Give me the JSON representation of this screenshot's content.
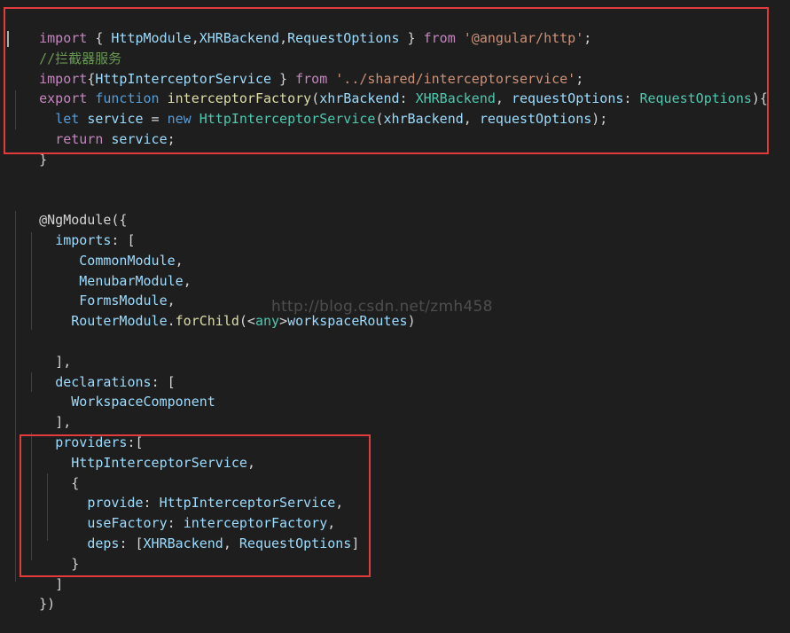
{
  "code": {
    "l1": {
      "t1": "import",
      "t2": " { ",
      "t3": "HttpModule",
      "t4": ",",
      "t5": "XHRBackend",
      "t6": ",",
      "t7": "RequestOptions",
      "t8": " } ",
      "t9": "from",
      "t10": " ",
      "t11": "'@angular/http'",
      "t12": ";"
    },
    "l2": {
      "t1": "//拦截器服务"
    },
    "l3": {
      "t1": "import",
      "t2": "{",
      "t3": "HttpInterceptorService",
      "t4": " } ",
      "t5": "from",
      "t6": " ",
      "t7": "'../shared/interceptorservice'",
      "t8": ";"
    },
    "l4": {
      "t1": "export",
      "t2": " ",
      "t3": "function",
      "t4": " ",
      "t5": "interceptorFactory",
      "t6": "(",
      "t7": "xhrBackend",
      "t8": ": ",
      "t9": "XHRBackend",
      "t10": ", ",
      "t11": "requestOptions",
      "t12": ": ",
      "t13": "RequestOptions",
      "t14": "){"
    },
    "l5": {
      "t1": "  ",
      "t2": "let",
      "t3": " ",
      "t4": "service",
      "t5": " = ",
      "t6": "new",
      "t7": " ",
      "t8": "HttpInterceptorService",
      "t9": "(",
      "t10": "xhrBackend",
      "t11": ", ",
      "t12": "requestOptions",
      "t13": ");"
    },
    "l6": {
      "t1": "  ",
      "t2": "return",
      "t3": " ",
      "t4": "service",
      "t5": ";"
    },
    "l7": {
      "t1": "}"
    },
    "l8": {
      "t1": "@NgModule",
      "t2": "({"
    },
    "l9": {
      "t1": "  ",
      "t2": "imports",
      "t3": ": ["
    },
    "l10": {
      "t1": "     ",
      "t2": "CommonModule",
      "t3": ","
    },
    "l11": {
      "t1": "     ",
      "t2": "MenubarModule",
      "t3": ","
    },
    "l12": {
      "t1": "     ",
      "t2": "FormsModule",
      "t3": ","
    },
    "l13": {
      "t1": "    ",
      "t2": "RouterModule",
      "t3": ".",
      "t4": "forChild",
      "t5": "(<",
      "t6": "any",
      "t7": ">",
      "t8": "workspaceRoutes",
      "t9": ")"
    },
    "l14": {
      "t1": "  ",
      "t2": "],"
    },
    "l15": {
      "t1": "  ",
      "t2": "declarations",
      "t3": ": ["
    },
    "l16": {
      "t1": "    ",
      "t2": "WorkspaceComponent"
    },
    "l17": {
      "t1": "  ",
      "t2": "],"
    },
    "l18": {
      "t1": "  ",
      "t2": "providers",
      "t3": ":["
    },
    "l19": {
      "t1": "    ",
      "t2": "HttpInterceptorService",
      "t3": ","
    },
    "l20": {
      "t1": "    ",
      "t2": "{"
    },
    "l21": {
      "t1": "      ",
      "t2": "provide",
      "t3": ": ",
      "t4": "HttpInterceptorService",
      "t5": ","
    },
    "l22": {
      "t1": "      ",
      "t2": "useFactory",
      "t3": ": ",
      "t4": "interceptorFactory",
      "t5": ","
    },
    "l23": {
      "t1": "      ",
      "t2": "deps",
      "t3": ": [",
      "t4": "XHRBackend",
      "t5": ", ",
      "t6": "RequestOptions",
      "t7": "]"
    },
    "l24": {
      "t1": "    ",
      "t2": "}"
    },
    "l25": {
      "t1": "  ",
      "t2": "]"
    },
    "l26": {
      "t1": "})"
    }
  },
  "watermark": "http://blog.csdn.net/zmh458",
  "colors": {
    "background": "#1e1e1e",
    "highlight_border": "#e23b3b",
    "keyword_control": "#c586c0",
    "keyword": "#569cd6",
    "variable": "#9cdcfe",
    "type": "#4ec9b0",
    "function": "#dcdcaa",
    "string": "#ce9178",
    "comment": "#6a9955"
  }
}
